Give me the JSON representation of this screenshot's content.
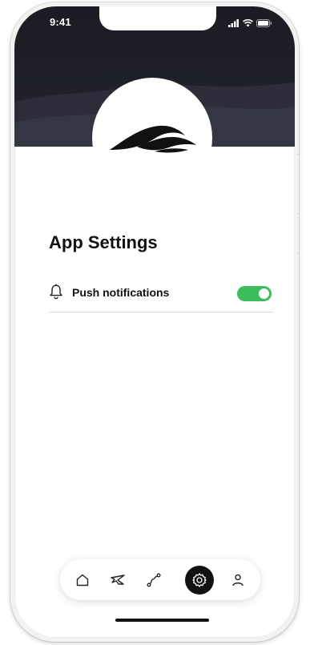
{
  "status_bar": {
    "time": "9:41",
    "icons": [
      "signal-icon",
      "wifi-icon",
      "battery-icon"
    ]
  },
  "header": {
    "logo_icon": "wave-logo-icon"
  },
  "page": {
    "title": "App Settings"
  },
  "settings": [
    {
      "icon": "bell-icon",
      "label": "Push notifications",
      "enabled": true
    }
  ],
  "tab_bar": {
    "items": [
      {
        "name": "home-icon",
        "active": false
      },
      {
        "name": "plane-icon",
        "active": false
      },
      {
        "name": "route-icon",
        "active": false
      },
      {
        "name": "settings-gear-icon",
        "active": true
      },
      {
        "name": "profile-icon",
        "active": false
      }
    ]
  },
  "colors": {
    "header_dark": "#1f2029",
    "toggle_on": "#3dbd5a",
    "active_tab": "#111111"
  }
}
